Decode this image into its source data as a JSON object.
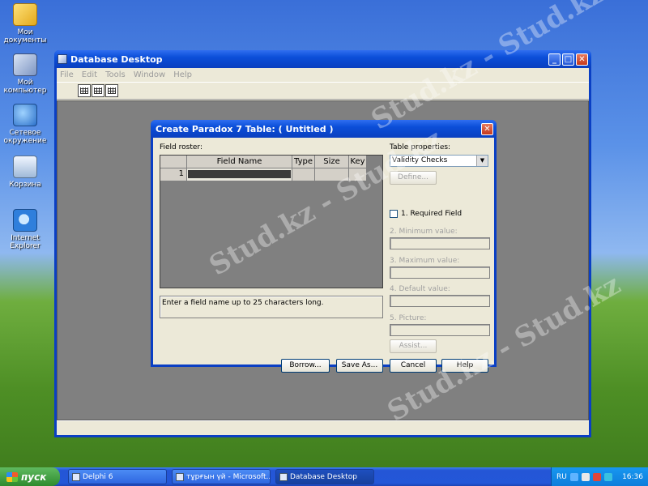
{
  "desktop": {
    "icons": [
      {
        "label": "Мои документы",
        "icon": "my-documents-icon"
      },
      {
        "label": "Мой компьютер",
        "icon": "my-computer-icon"
      },
      {
        "label": "Сетевое окружение",
        "icon": "network-icon"
      },
      {
        "label": "Корзина",
        "icon": "recycle-bin-icon"
      },
      {
        "label": "Internet Explorer",
        "icon": "internet-explorer-icon"
      }
    ],
    "watermark": "Stud.kz - Stud.kz"
  },
  "main_window": {
    "title": "Database Desktop",
    "menu": [
      "File",
      "Edit",
      "Tools",
      "Window",
      "Help"
    ],
    "controls": {
      "minimize": "_",
      "maximize": "□",
      "close": "✕"
    }
  },
  "dialog": {
    "title": "Create Paradox 7 Table:  ( Untitled )",
    "close": "✕",
    "field_roster_label": "Field roster:",
    "columns": [
      "",
      "Field Name",
      "Type",
      "Size",
      "Key"
    ],
    "rows": [
      {
        "num": "1",
        "name": "",
        "type": "",
        "size": "",
        "key": ""
      }
    ],
    "hint": "Enter a field name up to 25 characters long.",
    "table_properties_label": "Table properties:",
    "table_properties_value": "Validity Checks",
    "define_button": "Define...",
    "required_field_label": "1. Required Field",
    "minimum_value_label": "2. Minimum value:",
    "maximum_value_label": "3. Maximum value:",
    "default_value_label": "4. Default value:",
    "picture_label": "5. Picture:",
    "assist_button": "Assist...",
    "borrow_button": "Borrow...",
    "save_as_button": "Save As...",
    "cancel_button": "Cancel",
    "help_button": "Help"
  },
  "taskbar": {
    "start_label": "пуск",
    "tasks": [
      {
        "label": "Delphi 6",
        "active": false
      },
      {
        "label": "тұрғын үй - Microsoft...",
        "active": false
      },
      {
        "label": "Database Desktop",
        "active": true
      }
    ],
    "language": "RU",
    "clock": "16:36"
  }
}
